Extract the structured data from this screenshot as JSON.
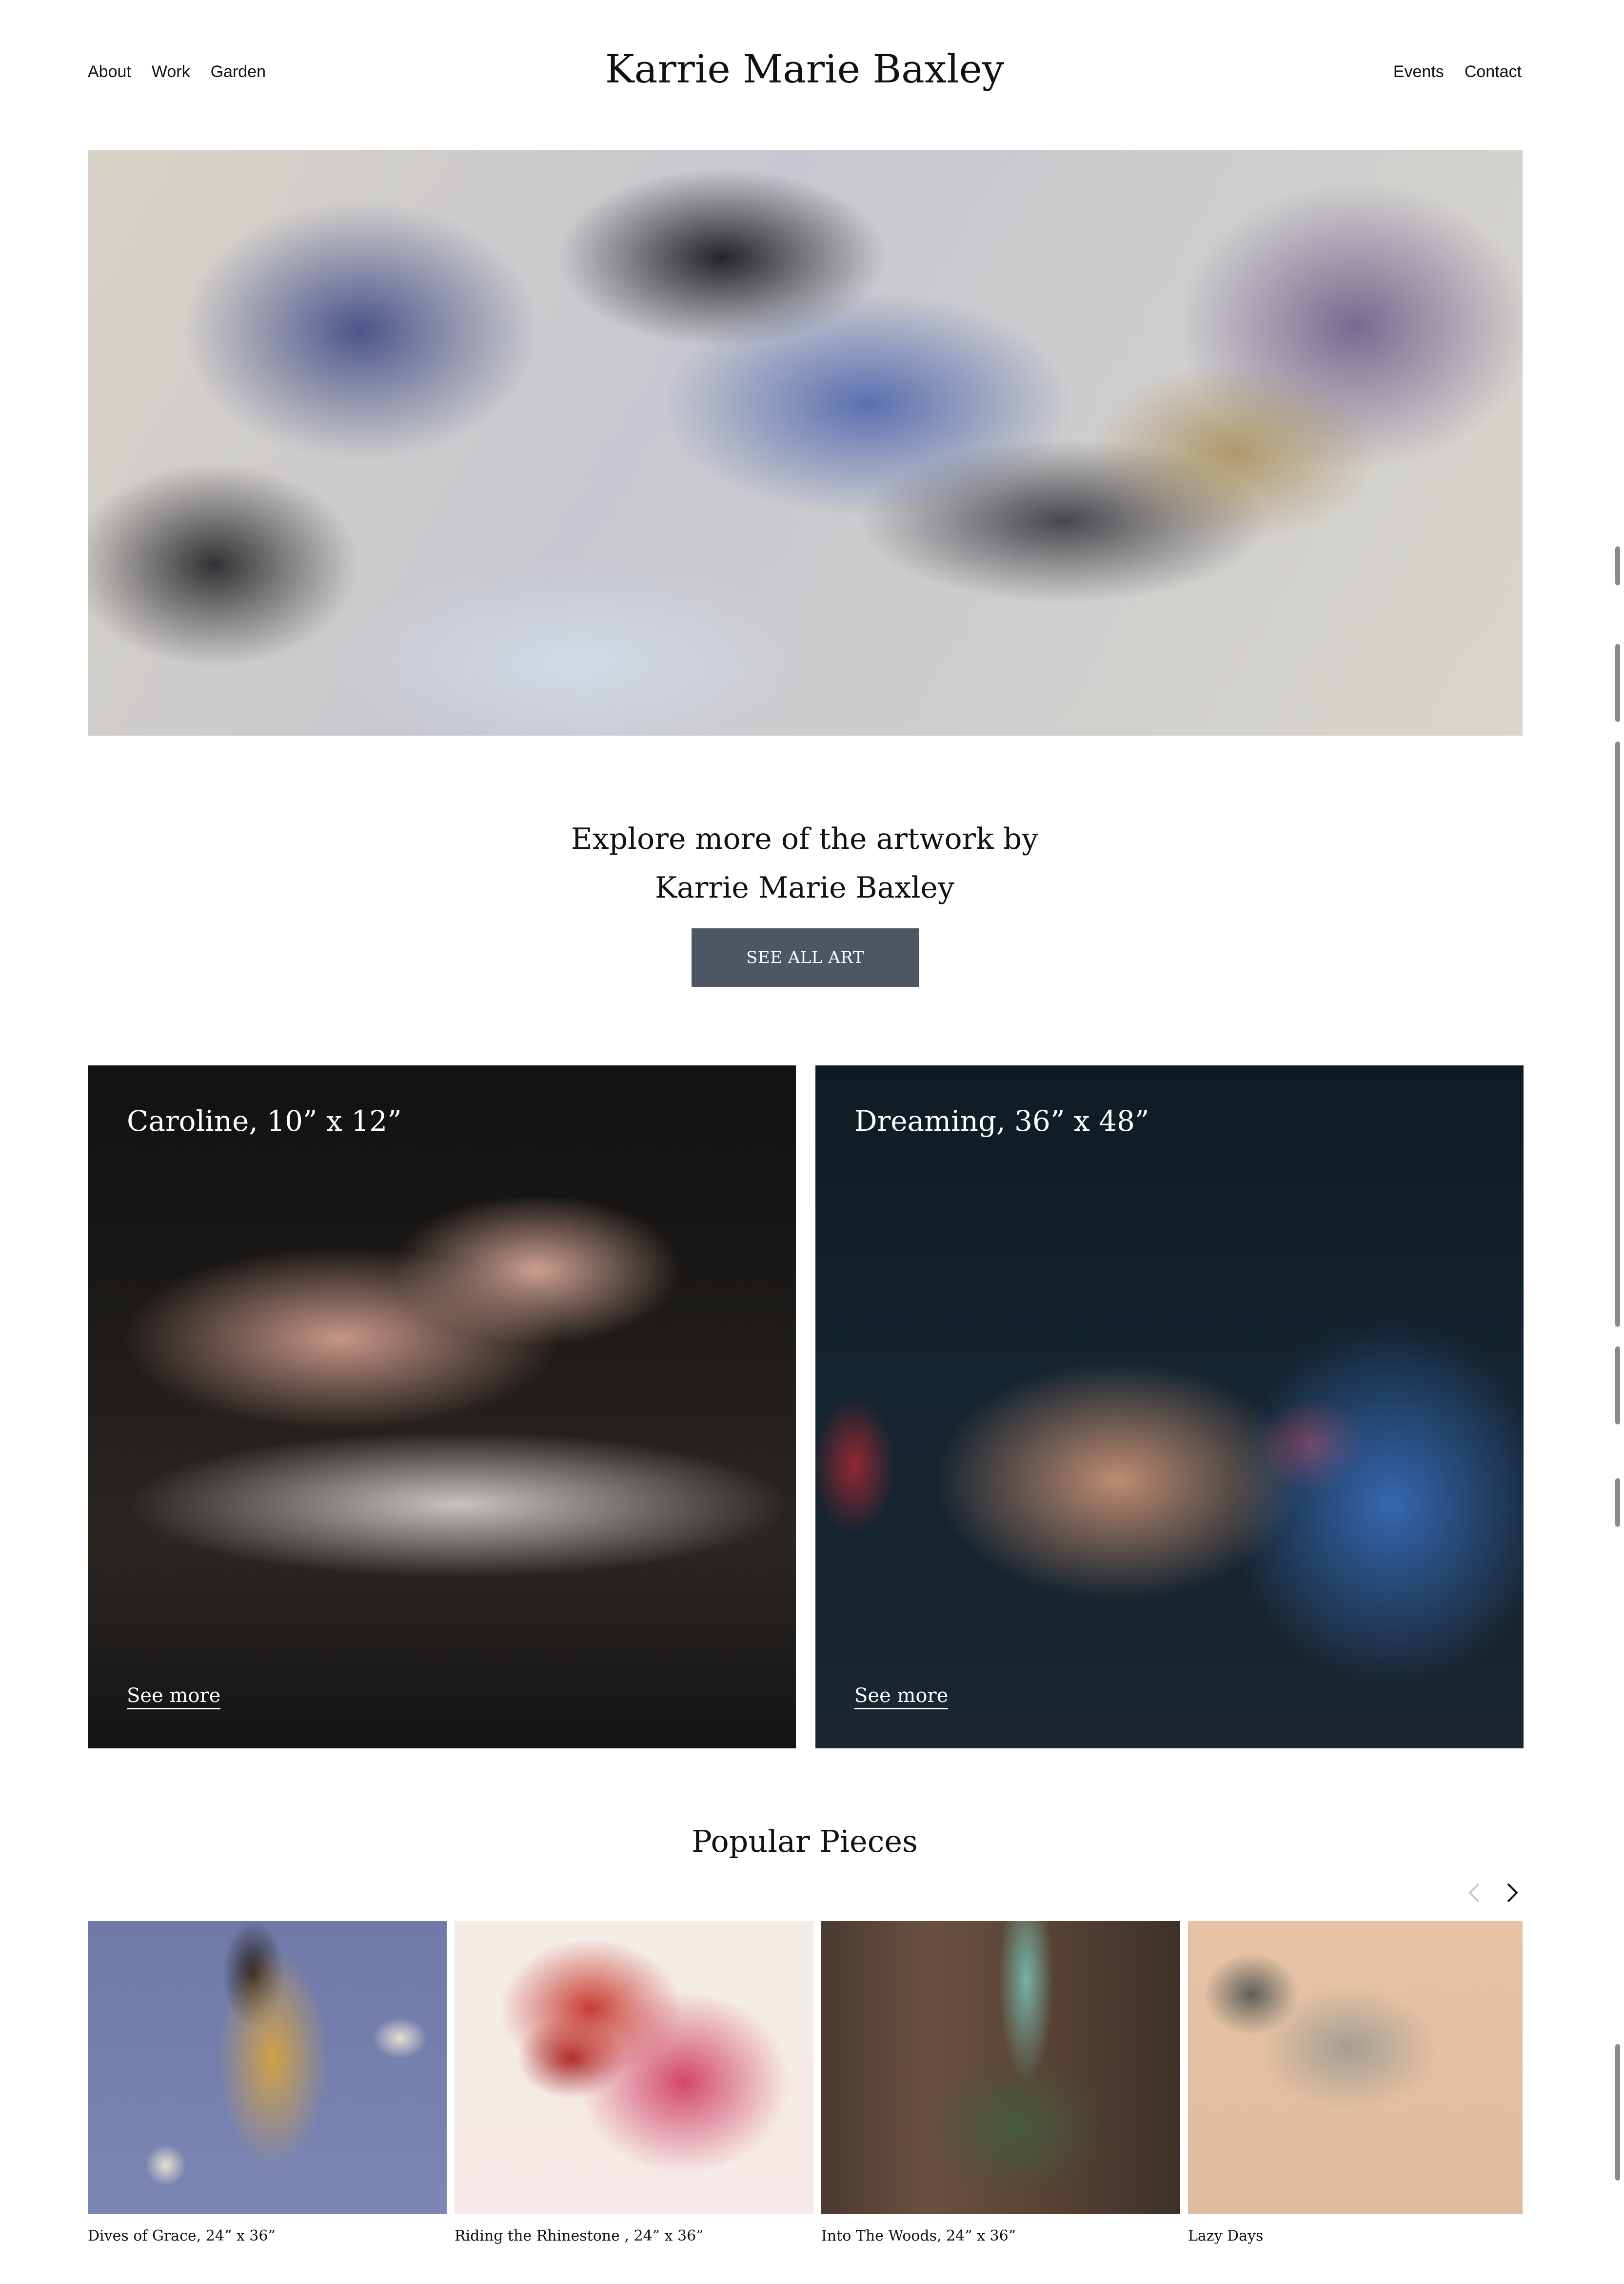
{
  "header": {
    "title": "Karrie Marie Baxley",
    "nav_left": [
      "About",
      "Work",
      "Garden"
    ],
    "nav_right": [
      "Events",
      "Contact"
    ]
  },
  "explore": {
    "line1": "Explore more of the artwork by",
    "line2": "Karrie Marie Baxley",
    "button_label": "SEE ALL ART"
  },
  "features": [
    {
      "title": "Caroline, 10” x 12”",
      "link_label": "See more"
    },
    {
      "title": "Dreaming, 36” x 48”",
      "link_label": "See more"
    }
  ],
  "popular": {
    "heading": "Popular Pieces",
    "items": [
      {
        "caption": "Dives of Grace, 24” x 36”"
      },
      {
        "caption": "Riding the Rhinestone , 24” x 36”"
      },
      {
        "caption": "Into The Woods, 24” x 36”"
      },
      {
        "caption": "Lazy Days"
      }
    ]
  },
  "icons": {
    "prev": "chevron-left-icon",
    "next": "chevron-right-icon"
  },
  "colors": {
    "button_bg": "#4f5663",
    "text": "#111111",
    "background": "#ffffff"
  }
}
